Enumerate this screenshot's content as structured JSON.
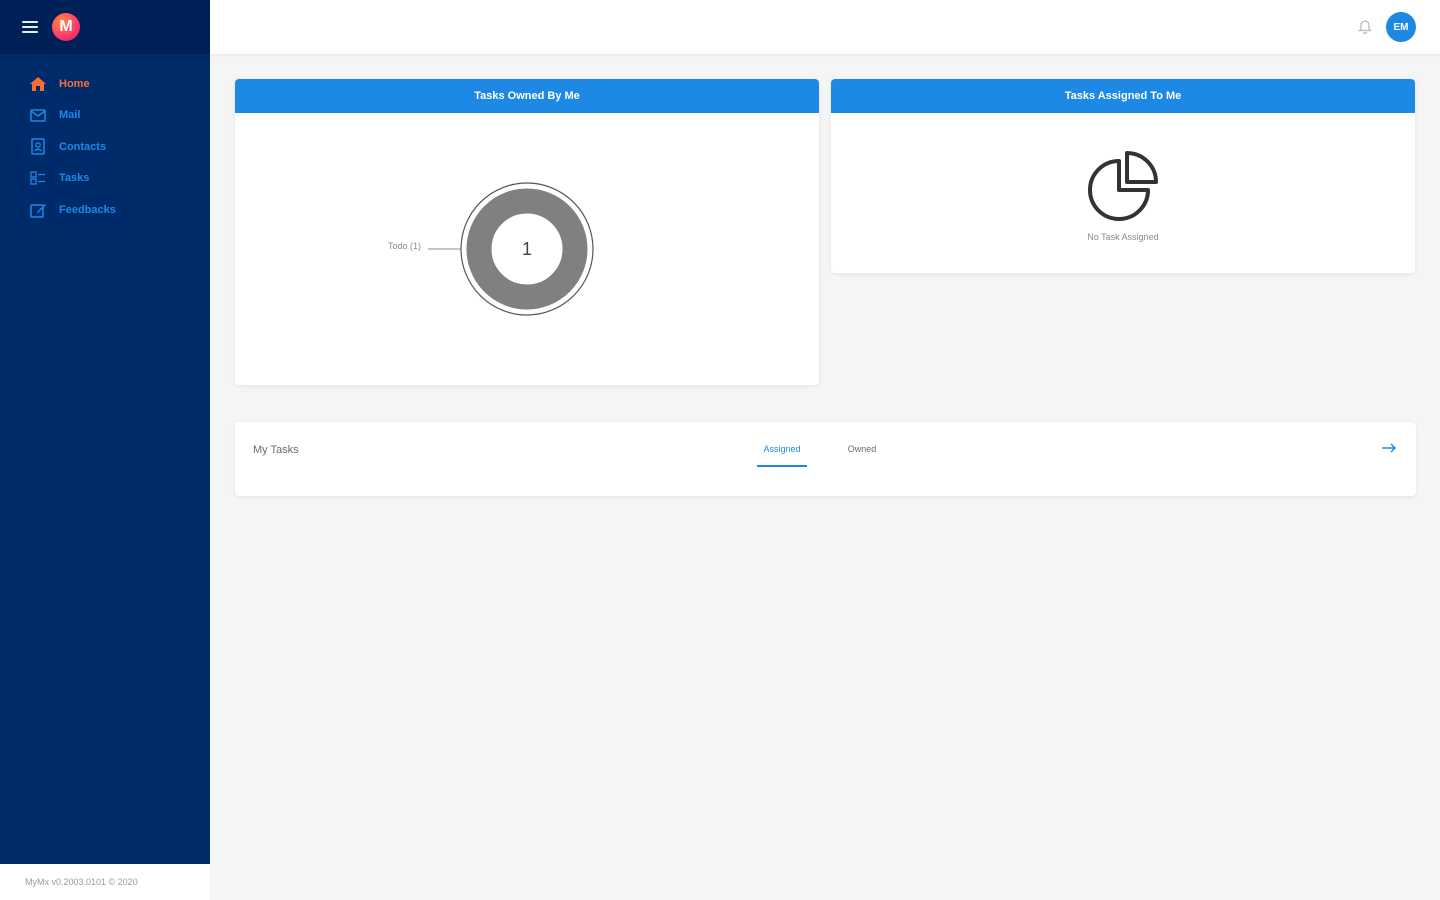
{
  "app": {
    "logo_letter": "M",
    "brand_color": "#1e88e5",
    "sidebar_color": "#002b6b"
  },
  "sidebar": {
    "items": [
      {
        "label": "Home",
        "icon": "home-icon",
        "active": true
      },
      {
        "label": "Mail",
        "icon": "mail-icon",
        "active": false
      },
      {
        "label": "Contacts",
        "icon": "contacts-icon",
        "active": false
      },
      {
        "label": "Tasks",
        "icon": "tasks-icon",
        "active": false
      },
      {
        "label": "Feedbacks",
        "icon": "feedback-icon",
        "active": false
      }
    ],
    "footer": "MyMx v0.2003.0101 © 2020"
  },
  "header": {
    "avatar_initials": "EM",
    "bell_icon": "bell-icon"
  },
  "owned_card": {
    "title": "Tasks Owned By Me",
    "chart_data": {
      "type": "pie",
      "slices": [
        {
          "label": "Todo (1)",
          "value": 1,
          "color": "#808080"
        }
      ],
      "center_text": "1"
    }
  },
  "assigned_card": {
    "title": "Tasks Assigned To Me",
    "empty_icon": "pie-chart-icon",
    "empty_text": "No Task Assigned"
  },
  "my_tasks": {
    "title": "My Tasks",
    "tabs": [
      {
        "label": "Assigned",
        "active": true
      },
      {
        "label": "Owned",
        "active": false
      }
    ],
    "arrow_icon": "arrow-right-icon"
  }
}
